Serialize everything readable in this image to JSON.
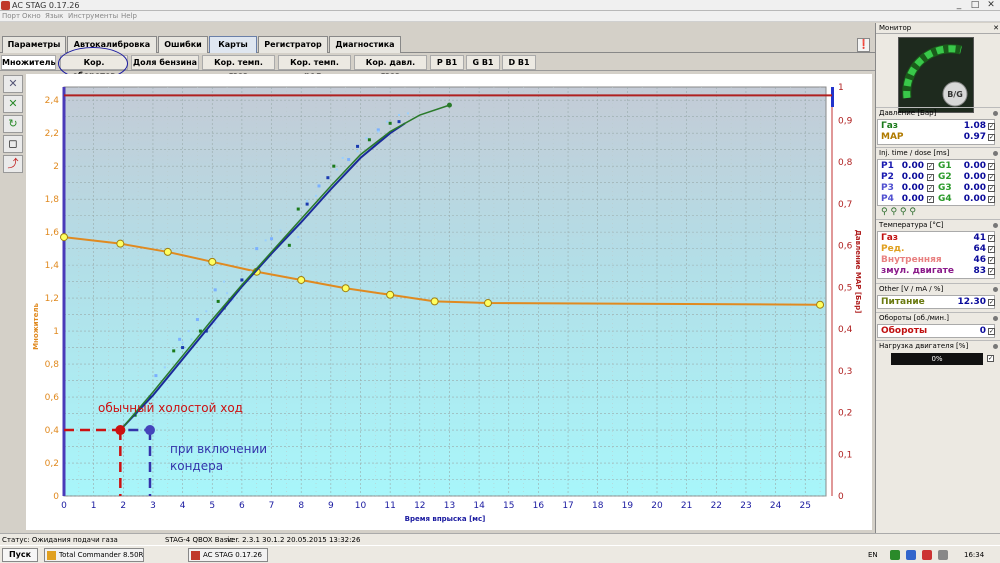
{
  "window": {
    "title": "AC STAG 0.17.26",
    "minimize": "_",
    "maximize": "□",
    "close": "✕"
  },
  "menu": [
    "Порт",
    "Окно",
    "Язык",
    "Инструменты",
    "Help"
  ],
  "main_tabs": [
    {
      "label": "Параметры",
      "active": false
    },
    {
      "label": "Автокалибровка",
      "active": false
    },
    {
      "label": "Ошибки",
      "active": false
    },
    {
      "label": "Карты",
      "active": true
    },
    {
      "label": "Регистратор",
      "active": false
    },
    {
      "label": "Диагностика",
      "active": false
    }
  ],
  "sub_tabs": [
    {
      "label": "Множитель",
      "active": true
    },
    {
      "label": "Кор. оборотов",
      "active": false
    },
    {
      "label": "Доля бензина",
      "active": false
    },
    {
      "label": "Кор. темп. газа",
      "active": false
    },
    {
      "label": "Кор. темп. ред.",
      "active": false
    },
    {
      "label": "Кор. давл. газа",
      "active": false
    },
    {
      "label": "P B1",
      "active": false
    },
    {
      "label": "G B1",
      "active": false
    },
    {
      "label": "D B1",
      "active": false
    }
  ],
  "colors": {
    "accent": "#1a1aa0",
    "map_line": "#e08a20",
    "fit_line": "#2a7a2a",
    "pressure_line": "#b02020",
    "annot_red": "#cc1111",
    "annot_blue": "#3333aa"
  },
  "chart_data": {
    "type": "line",
    "xlabel": "Время впрыска [мс]",
    "ylabel": "Множитель",
    "y2label": "Давление МАР [Бар]",
    "xlim": [
      0,
      25.7
    ],
    "ylim": [
      0,
      2.48
    ],
    "y2lim": [
      0,
      0.98
    ],
    "x_ticks": [
      0,
      1,
      2,
      3,
      4,
      5,
      6,
      7,
      8,
      9,
      10,
      11,
      12,
      13,
      14,
      15,
      16,
      17,
      18,
      19,
      20,
      21,
      22,
      23,
      24,
      25
    ],
    "y_ticks": [
      0,
      0.2,
      0.4,
      0.6,
      0.8,
      1,
      1.2,
      1.4,
      1.6,
      1.8,
      2,
      2.2,
      2.4
    ],
    "y_tick_labels": [
      "0",
      "0,2",
      "0,4",
      "0,6",
      "0,8",
      "1",
      "1,2",
      "1,4",
      "1,6",
      "1,8",
      "2",
      "2,2",
      "2,4"
    ],
    "y2_ticks": [
      0,
      0.1,
      0.2,
      0.3,
      0.4,
      0.5,
      0.6,
      0.7,
      0.8,
      0.9
    ],
    "y2_tick_labels": [
      "0",
      "0,1",
      "0,2",
      "0,3",
      "0,4",
      "0,5",
      "0,6",
      "0,7",
      "0,8",
      "0,9"
    ],
    "y2_top_label": "1",
    "grid": true,
    "multiplier_map": {
      "x": [
        0,
        1.9,
        3.5,
        5,
        6.5,
        8,
        9.5,
        11,
        12.5,
        14.3,
        25.5
      ],
      "y": [
        1.57,
        1.53,
        1.48,
        1.42,
        1.36,
        1.31,
        1.26,
        1.22,
        1.18,
        1.17,
        1.16
      ]
    },
    "fit_curve": {
      "x": [
        2,
        3,
        4,
        5,
        6,
        7,
        8,
        9,
        10,
        11,
        12,
        13
      ],
      "y": [
        0.42,
        0.63,
        0.85,
        1.07,
        1.28,
        1.48,
        1.68,
        1.88,
        2.07,
        2.21,
        2.31,
        2.37
      ]
    },
    "fit_curve_blue": {
      "x": [
        2,
        3,
        4,
        5,
        6,
        7,
        8,
        9,
        10,
        11,
        11.5
      ],
      "y": [
        0.42,
        0.61,
        0.83,
        1.05,
        1.27,
        1.47,
        1.66,
        1.86,
        2.05,
        2.2,
        2.26
      ]
    },
    "samples": [
      {
        "x": 2.4,
        "y": 0.49
      },
      {
        "x": 2.9,
        "y": 0.6
      },
      {
        "x": 3.1,
        "y": 0.73
      },
      {
        "x": 3.7,
        "y": 0.88
      },
      {
        "x": 4.0,
        "y": 0.9
      },
      {
        "x": 4.5,
        "y": 1.07
      },
      {
        "x": 4.6,
        "y": 1.0
      },
      {
        "x": 4.8,
        "y": 1.0
      },
      {
        "x": 5.1,
        "y": 1.25
      },
      {
        "x": 5.2,
        "y": 1.18
      },
      {
        "x": 5.6,
        "y": 1.19
      },
      {
        "x": 6.5,
        "y": 1.5
      },
      {
        "x": 7.6,
        "y": 1.52
      },
      {
        "x": 8.2,
        "y": 1.77
      },
      {
        "x": 8.6,
        "y": 1.88
      },
      {
        "x": 9.1,
        "y": 2.0
      },
      {
        "x": 9.9,
        "y": 2.12
      },
      {
        "x": 10.6,
        "y": 2.22
      },
      {
        "x": 11.0,
        "y": 2.26
      },
      {
        "x": 11.3,
        "y": 2.27
      },
      {
        "x": 3.9,
        "y": 0.95
      },
      {
        "x": 5.4,
        "y": 1.14
      },
      {
        "x": 6.0,
        "y": 1.31
      },
      {
        "x": 7.0,
        "y": 1.56
      },
      {
        "x": 7.9,
        "y": 1.74
      },
      {
        "x": 8.9,
        "y": 1.93
      },
      {
        "x": 9.6,
        "y": 2.04
      },
      {
        "x": 10.3,
        "y": 2.16
      }
    ],
    "pressure_line_y2": 0.96,
    "annotations": {
      "idle_label": "обычный холостой ход",
      "ac_label_1": "при включении",
      "ac_label_2": "кондера",
      "idle_point": {
        "x": 1.9,
        "y": 0.4
      },
      "ac_point": {
        "x": 2.9,
        "y": 0.4
      }
    }
  },
  "status": {
    "left": "Статус: Ожидания подачи газа",
    "device": "STAG-4 QBOX Basic",
    "version": "ver. 2.3.1  30.1.2  20.05.2015 13:32:26"
  },
  "taskbar": {
    "start": "Пуск",
    "tasks": [
      "Total Commander 8.50R...",
      "AC STAG 0.17.26"
    ],
    "lang": "EN",
    "clock": "16:34"
  },
  "monitor": {
    "title": "Монитор",
    "gauge_label": "B/G",
    "sections": {
      "pressure": "Давление [Бар]",
      "inj": "Inj. time / dose [ms]",
      "temp": "Температура [°C]",
      "other": "Other [V / mA / %]",
      "rpm": "Обороты [об./мин.]",
      "load": "Нагрузка двигателя [%]"
    },
    "pressure_rows": [
      {
        "label": "Газ",
        "value": "1.08"
      },
      {
        "label": "MAP",
        "value": "0.97"
      }
    ],
    "inj_rows": [
      {
        "p": "P1",
        "pv": "0.00",
        "g": "G1",
        "gv": "0.00"
      },
      {
        "p": "P2",
        "pv": "0.00",
        "g": "G2",
        "gv": "0.00"
      },
      {
        "p": "P3",
        "pv": "0.00",
        "g": "G3",
        "gv": "0.00"
      },
      {
        "p": "P4",
        "pv": "0.00",
        "g": "G4",
        "gv": "0.00"
      }
    ],
    "temp_rows": [
      {
        "label": "Газ",
        "value": "41"
      },
      {
        "label": "Ред.",
        "value": "64"
      },
      {
        "label": "Внутренняя",
        "value": "46"
      },
      {
        "label": "змул. двигате",
        "value": "83"
      }
    ],
    "supply": {
      "label": "Питание",
      "value": "12.30"
    },
    "rpm_row": {
      "label": "Обороты",
      "value": "0"
    },
    "load_value": "0%"
  }
}
